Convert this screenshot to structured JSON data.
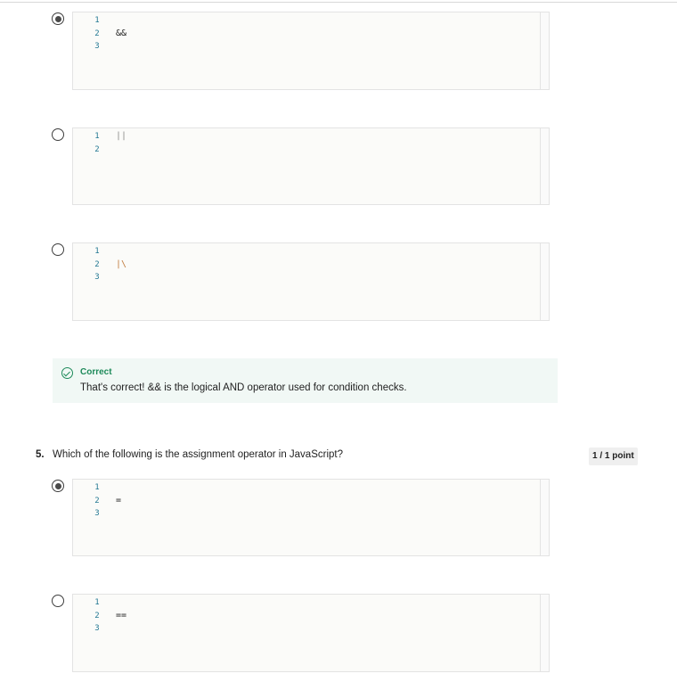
{
  "question4": {
    "options": [
      {
        "lines": [
          "1",
          "2",
          "3"
        ],
        "code_line": 2,
        "code": "&&",
        "selected": true
      },
      {
        "lines": [
          "1",
          "2"
        ],
        "code_line": 1,
        "code": "||",
        "selected": false
      },
      {
        "lines": [
          "1",
          "2",
          "3"
        ],
        "code_line": 2,
        "code": "|\\",
        "selected": false
      }
    ],
    "feedback": {
      "status": "Correct",
      "message": "That's correct! && is the logical AND operator used for condition checks."
    }
  },
  "question5": {
    "number": "5.",
    "text": "Which of the following is the assignment operator in JavaScript?",
    "points": "1 / 1 point",
    "options": [
      {
        "lines": [
          "1",
          "2",
          "3"
        ],
        "code_line": 2,
        "code": "=",
        "selected": true
      },
      {
        "lines": [
          "1",
          "2",
          "3"
        ],
        "code_line": 2,
        "code": "==",
        "selected": false
      }
    ]
  },
  "colors": {
    "correct_green": "#1e8a5a",
    "feedback_bg": "#f1f8f5",
    "line_number": "#237893"
  },
  "icons": {
    "radio_selected": "radio-selected-icon",
    "radio_unselected": "radio-unselected-icon",
    "feedback": "check-circle-icon"
  }
}
